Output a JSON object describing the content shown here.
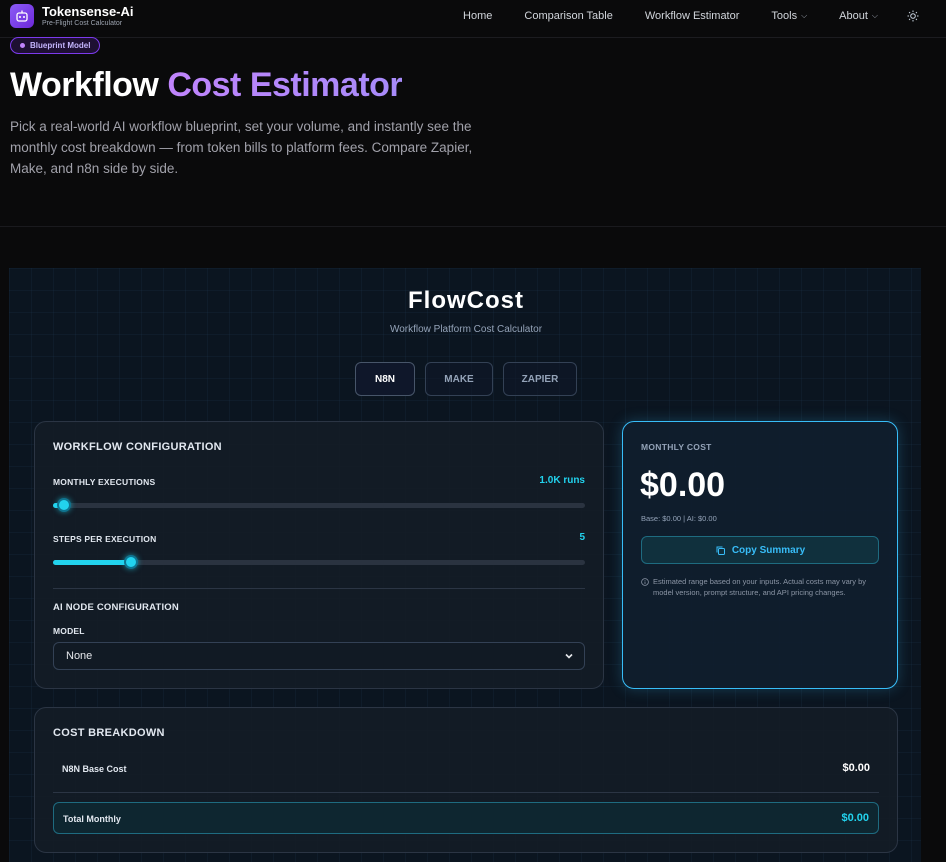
{
  "nav": {
    "brand_name": "Tokensense-Ai",
    "brand_tagline": "Pre-Flight Cost Calculator",
    "links": [
      {
        "label": "Home"
      },
      {
        "label": "Comparison Table"
      },
      {
        "label": "Workflow Estimator"
      },
      {
        "label": "Tools"
      },
      {
        "label": "About"
      }
    ]
  },
  "hero": {
    "badge": "Blueprint Model",
    "title_plain": "Workflow ",
    "title_accent": "Cost Estimator",
    "description": "Pick a real-world AI workflow blueprint, set your volume, and instantly see the monthly cost breakdown — from token bills to platform fees. Compare Zapier, Make, and n8n side by side."
  },
  "calculator": {
    "title": "FlowCost",
    "subtitle": "Workflow Platform Cost Calculator",
    "platforms": [
      "N8N",
      "MAKE",
      "ZAPIER"
    ],
    "active_platform": "N8N"
  },
  "config": {
    "heading": "WORKFLOW CONFIGURATION",
    "executions_label": "MONTHLY EXECUTIONS",
    "executions_value": "1.0K runs",
    "executions_fraction": 0.02,
    "steps_label": "STEPS PER EXECUTION",
    "steps_value": "5",
    "steps_fraction": 0.147,
    "ai_heading": "AI NODE CONFIGURATION",
    "model_label": "MODEL",
    "model_value": "None"
  },
  "monthly": {
    "label": "MONTHLY COST",
    "amount": "$0.00",
    "base_line": "Base: $0.00 | AI: $0.00",
    "copy_label": "Copy Summary",
    "disclaimer": "Estimated range based on your inputs. Actual costs may vary by model version, prompt structure, and API pricing changes."
  },
  "breakdown": {
    "heading": "COST BREAKDOWN",
    "base_label": "N8N Base Cost",
    "base_value": "$0.00",
    "total_label": "Total Monthly",
    "total_value": "$0.00"
  },
  "colors": {
    "accent_purple": "#a78bfa",
    "accent_cyan": "#22d3ee",
    "background": "#0a0a0b"
  }
}
